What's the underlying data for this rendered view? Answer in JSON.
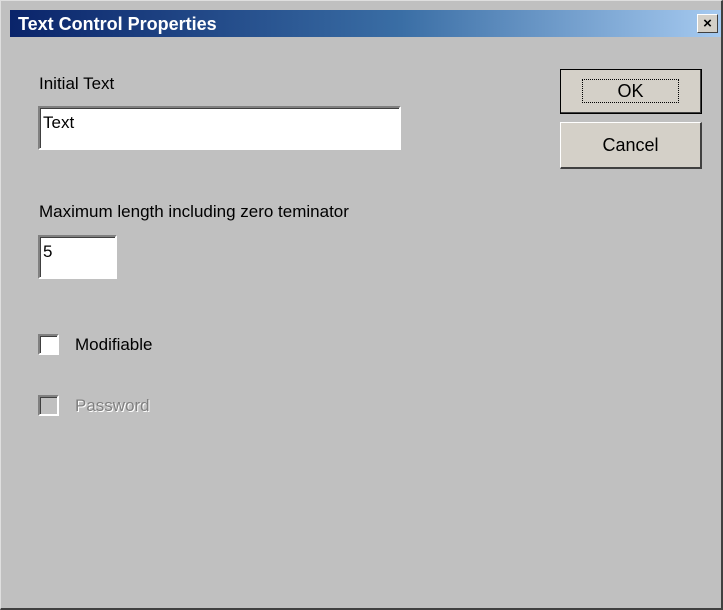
{
  "window": {
    "title": "Text Control Properties",
    "close_glyph": "×"
  },
  "form": {
    "initial_text_label": "Initial Text",
    "initial_text_value": "Text",
    "max_length_label": "Maximum length including zero teminator",
    "max_length_value": "5",
    "modifiable_label": "Modifiable",
    "modifiable_checked": false,
    "password_label": "Password",
    "password_checked": false,
    "password_enabled": false
  },
  "buttons": {
    "ok_label": "OK",
    "cancel_label": "Cancel"
  },
  "colors": {
    "dialog_face": "#c0c0c0",
    "title_start": "#0a246a",
    "title_end": "#a6caf0",
    "disabled_text": "#808080"
  },
  "icons": {
    "close": "close-icon"
  }
}
